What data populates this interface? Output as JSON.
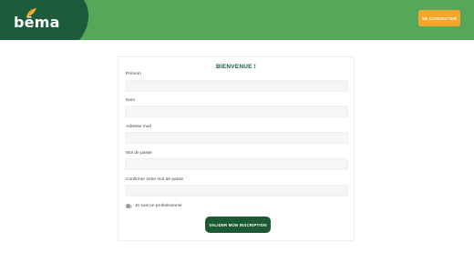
{
  "header": {
    "logo_text": "bēma",
    "login_label": "SE CONNECTER"
  },
  "form": {
    "title": "BIENVENUE !",
    "fields": [
      {
        "label": "Prénom",
        "value": ""
      },
      {
        "label": "Nom",
        "value": ""
      },
      {
        "label": "Adresse mail",
        "value": ""
      },
      {
        "label": "Mot de passe",
        "value": ""
      },
      {
        "label": "Confirmer votre mot de passe",
        "value": ""
      }
    ],
    "professional_label": "Je suis un professionnel",
    "professional_checked": false,
    "submit_label": "VALIDER MON INSCRIPTION"
  },
  "colors": {
    "header_green": "#55a75a",
    "header_dark": "#1d5b3a",
    "accent_orange": "#f6a629",
    "submit_green": "#1b5a34"
  }
}
